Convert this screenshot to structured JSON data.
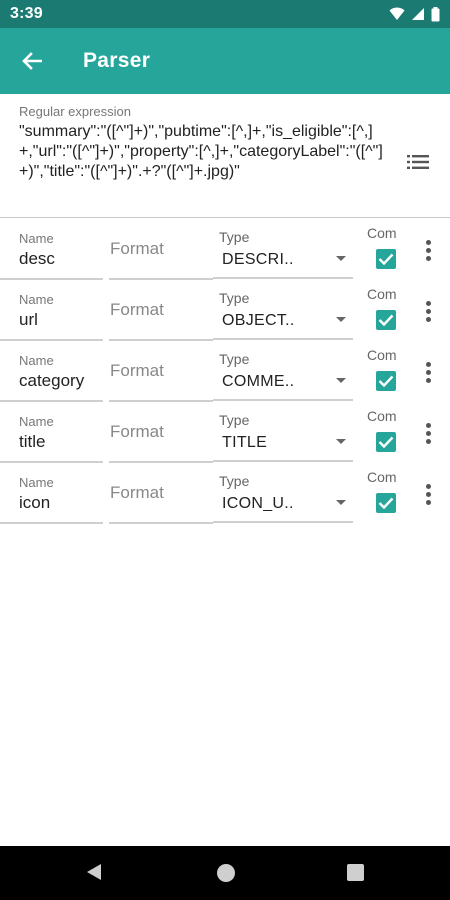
{
  "status_bar": {
    "time": "3:39"
  },
  "app_bar": {
    "title": "Parser"
  },
  "regex": {
    "label": "Regular expression",
    "value": "\"summary\":\"([^\"]+)\",\"pubtime\":[^,]+,\"is_eligible\":[^,]+,\"url\":\"([^\"]+)\",\"property\":[^,]+,\"categoryLabel\":\"([^\"]+)\",\"title\":\"([^\"]+)\".+?\"([^\"]+.jpg)\""
  },
  "field_labels": {
    "name": "Name",
    "format": "Format",
    "type": "Type",
    "com": "Com"
  },
  "rows": [
    {
      "name": "desc",
      "type": "DESCRI..",
      "checked": true
    },
    {
      "name": "url",
      "type": "OBJECT..",
      "checked": true
    },
    {
      "name": "category",
      "type": "COMME..",
      "checked": true
    },
    {
      "name": "title",
      "type": "TITLE",
      "checked": true
    },
    {
      "name": "icon",
      "type": "ICON_U..",
      "checked": true
    }
  ],
  "colors": {
    "accent": "#26a69a",
    "status_bar": "#1b7a72",
    "nav_bar": "#000000"
  },
  "icons": {
    "back": "arrow-left-icon",
    "list": "list-icon",
    "more": "more-vert-icon",
    "checkbox": "check-icon"
  }
}
